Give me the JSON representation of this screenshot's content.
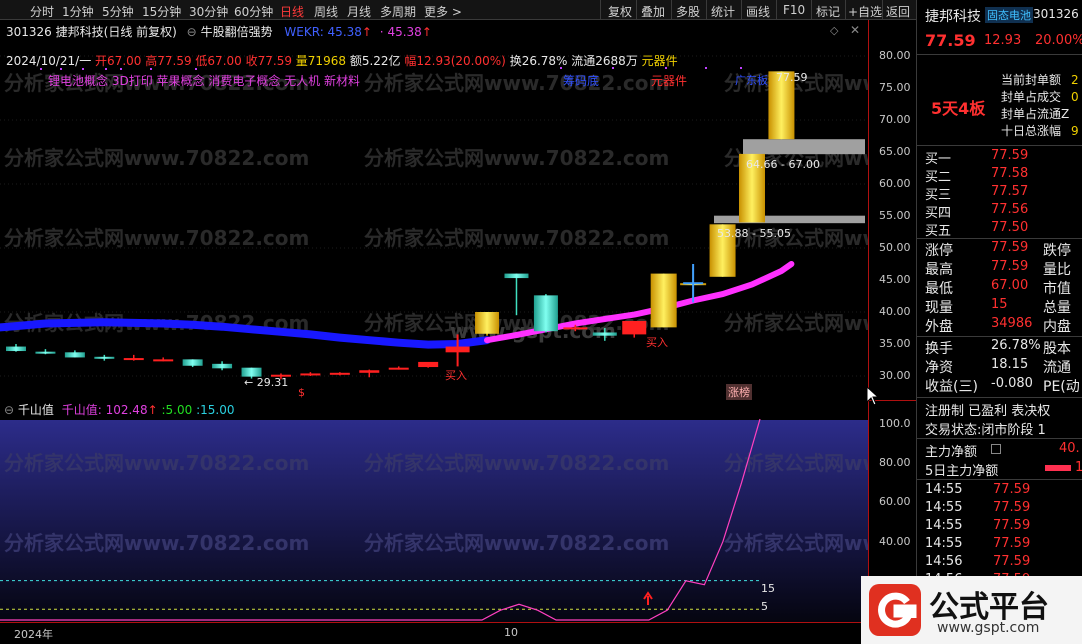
{
  "toolbar": {
    "left": [
      "分时",
      "1分钟",
      "5分钟",
      "15分钟",
      "30分钟",
      "60分钟",
      "日线",
      "周线",
      "月线",
      "多周期",
      "更多 >"
    ],
    "active": "日线",
    "right": [
      "复权",
      "叠加",
      "多股",
      "统计",
      "画线",
      "F10",
      "标记",
      "+自选",
      "返回"
    ]
  },
  "stock": {
    "code": "301326",
    "name": "捷邦科技",
    "mode": "(日线 前复权)",
    "indicator_name": "牛股翻倍强势",
    "wekr": "WEKR: 45.38",
    "wekr_val": "45.38",
    "date": "2024/10/21/一",
    "open": "开67.00",
    "high": "高77.59",
    "low": "低67.00",
    "close": "收77.59",
    "vol": "量71968",
    "amount": "额5.22亿",
    "range": "幅12.93(20.00%)",
    "turnover": "换26.78%",
    "float": "流通2688万",
    "sector": "元器件",
    "concepts": "锂电池概念 3D打印 苹果概念 消费电子概念 无人机 新材料"
  },
  "annotations": {
    "chip_bottom": "筹码底",
    "sector_label": "元器件",
    "dragon_list": "广东板",
    "top_price": "77.59",
    "zone1": "64.66 - 67.00",
    "zone2": "53.88 - 55.05",
    "low_price": "← 29.31",
    "buy1": "买入",
    "buy2": "买入",
    "limit_up": "涨榜",
    "dollar": "$"
  },
  "watermark": "分析家公式网www.70822.com",
  "center_watermark": "www.gspt.com",
  "main_yaxis": [
    "80.00",
    "75.00",
    "70.00",
    "65.00",
    "60.00",
    "55.00",
    "50.00",
    "45.00",
    "40.00",
    "35.00",
    "30.00"
  ],
  "sub": {
    "name": "千山值",
    "label": "千山值: 102.48",
    "v1": "5.00",
    "v2": "15.00",
    "line15": "15",
    "line5": "5",
    "yaxis": [
      "100.0",
      "80.00",
      "60.00",
      "40.00",
      "20.00"
    ]
  },
  "xaxis": {
    "year": "2024年",
    "month": "10"
  },
  "chart_data": {
    "type": "candlestick",
    "title": "捷邦科技 日线",
    "ylim": [
      27,
      82
    ],
    "candles": [
      {
        "o": 34.6,
        "h": 35.0,
        "l": 33.8,
        "c": 33.9
      },
      {
        "o": 33.8,
        "h": 34.2,
        "l": 33.4,
        "c": 33.6
      },
      {
        "o": 33.7,
        "h": 34.0,
        "l": 32.9,
        "c": 32.9
      },
      {
        "o": 33.0,
        "h": 33.3,
        "l": 32.4,
        "c": 32.7
      },
      {
        "o": 32.8,
        "h": 33.3,
        "l": 32.4,
        "c": 32.8
      },
      {
        "o": 32.6,
        "h": 32.9,
        "l": 32.3,
        "c": 32.6
      },
      {
        "o": 32.6,
        "h": 32.6,
        "l": 31.4,
        "c": 31.6
      },
      {
        "o": 31.9,
        "h": 32.3,
        "l": 30.9,
        "c": 31.2
      },
      {
        "o": 31.3,
        "h": 31.3,
        "l": 29.6,
        "c": 29.9
      },
      {
        "o": 30.0,
        "h": 30.4,
        "l": 29.5,
        "c": 30.2
      },
      {
        "o": 30.2,
        "h": 30.6,
        "l": 30.0,
        "c": 30.4
      },
      {
        "o": 30.3,
        "h": 30.6,
        "l": 30.1,
        "c": 30.5
      },
      {
        "o": 30.5,
        "h": 31.0,
        "l": 29.8,
        "c": 30.9
      },
      {
        "o": 31.1,
        "h": 31.5,
        "l": 31.0,
        "c": 31.3
      },
      {
        "o": 31.4,
        "h": 31.7,
        "l": 31.3,
        "c": 32.2
      },
      {
        "o": 33.7,
        "h": 35.2,
        "l": 33.1,
        "c": 34.6
      },
      {
        "o": 36.6,
        "h": 40.0,
        "l": 36.3,
        "c": 40.0
      },
      {
        "o": 46.0,
        "h": 46.0,
        "l": 39.5,
        "c": 45.3
      },
      {
        "o": 42.6,
        "h": 42.8,
        "l": 36.8,
        "c": 37.0
      },
      {
        "o": 37.5,
        "h": 38.0,
        "l": 37.0,
        "c": 37.6
      },
      {
        "o": 36.8,
        "h": 37.5,
        "l": 35.5,
        "c": 36.3
      },
      {
        "o": 36.5,
        "h": 38.6,
        "l": 36.0,
        "c": 38.6
      },
      {
        "o": 37.6,
        "h": 46.0,
        "l": 37.6,
        "c": 46.0
      },
      {
        "o": 44.3,
        "h": 47.0,
        "l": 42.5,
        "c": 44.5
      },
      {
        "o": 45.5,
        "h": 53.7,
        "l": 45.5,
        "c": 53.7
      },
      {
        "o": 54.0,
        "h": 64.7,
        "l": 54.0,
        "c": 64.7
      },
      {
        "o": 67.0,
        "h": 77.6,
        "l": 67.0,
        "c": 77.6
      }
    ],
    "ma_line": [
      37.8,
      38.2,
      38.3,
      38.4,
      38.3,
      38.2,
      38.0,
      37.7,
      37.3,
      36.9,
      36.5,
      36.0,
      35.6,
      35.2,
      34.9,
      35.0,
      35.6,
      36.4,
      37.3,
      38.2,
      38.9,
      39.6,
      40.6,
      41.8,
      42.8,
      44.3,
      46.4
    ],
    "sub_values": [
      0,
      0,
      0,
      0,
      0,
      0,
      0,
      0,
      0,
      0,
      0,
      0,
      0,
      0,
      0,
      0,
      0,
      0,
      0,
      0,
      0,
      0,
      0,
      0,
      0,
      0,
      0,
      5,
      8,
      5,
      0,
      0,
      0,
      0,
      0,
      0,
      5,
      20,
      18,
      40,
      70,
      102.48
    ]
  },
  "right": {
    "name": "捷邦科技",
    "concept": "固态电池",
    "code": "301326",
    "price": "77.59",
    "chg": "12.93",
    "pct": "20.00%",
    "board": "5天4板",
    "seal": [
      "当前封单额",
      "封单占成交",
      "封单占流通Z",
      "十日总涨幅"
    ],
    "seal_vals": [
      "2",
      "0",
      "",
      "9"
    ],
    "bids": [
      {
        "label": "买一",
        "price": "77.59"
      },
      {
        "label": "买二",
        "price": "77.58"
      },
      {
        "label": "买三",
        "price": "77.57"
      },
      {
        "label": "买四",
        "price": "77.56"
      },
      {
        "label": "买五",
        "price": "77.50"
      }
    ],
    "stats": [
      {
        "l": "涨停",
        "v": "77.59",
        "r": "跌停"
      },
      {
        "l": "最高",
        "v": "77.59",
        "r": "量比"
      },
      {
        "l": "最低",
        "v": "67.00",
        "r": "市值"
      },
      {
        "l": "现量",
        "v": "15",
        "r": "总量"
      },
      {
        "l": "外盘",
        "v": "34986",
        "r": "内盘"
      }
    ],
    "stats2": [
      {
        "l": "换手",
        "v": "26.78%",
        "r": "股本"
      },
      {
        "l": "净资",
        "v": "18.15",
        "r": "流通"
      },
      {
        "l": "收益(三)",
        "v": "-0.080",
        "r": "PE(动"
      }
    ],
    "info1": "注册制 已盈利 表决权",
    "info2": "交易状态:闭市阶段 1",
    "main_net": "主力净额",
    "main_net_val": "40.",
    "main_net5": "5日主力净额",
    "main_net5_val": "1.",
    "ticks": [
      {
        "t": "14:55",
        "p": "77.59"
      },
      {
        "t": "14:55",
        "p": "77.59"
      },
      {
        "t": "14:55",
        "p": "77.59"
      },
      {
        "t": "14:55",
        "p": "77.59"
      },
      {
        "t": "14:56",
        "p": "77.59"
      },
      {
        "t": "14:56",
        "p": "77.59"
      }
    ]
  },
  "logo": {
    "text": "公式平台",
    "url": "www.gspt.com"
  }
}
